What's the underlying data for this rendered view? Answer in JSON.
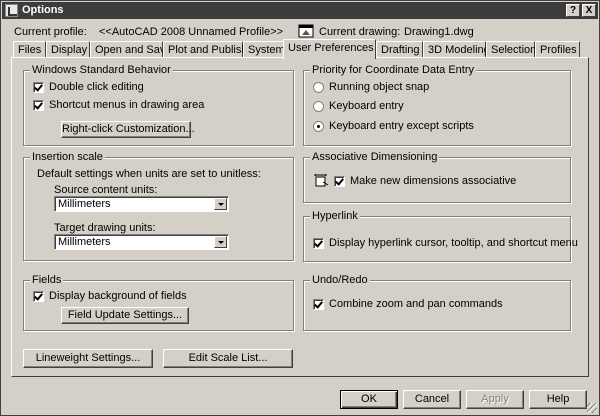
{
  "window": {
    "title": "Options",
    "help_glyph": "?",
    "close_glyph": "X"
  },
  "profile": {
    "label": "Current profile:",
    "value": "<<AutoCAD 2008 Unnamed Profile>>",
    "drawing_label": "Current drawing:",
    "drawing_value": "Drawing1.dwg"
  },
  "tabs": [
    {
      "label": "Files"
    },
    {
      "label": "Display"
    },
    {
      "label": "Open and Save"
    },
    {
      "label": "Plot and Publish"
    },
    {
      "label": "System"
    },
    {
      "label": "User Preferences"
    },
    {
      "label": "Drafting"
    },
    {
      "label": "3D Modeling"
    },
    {
      "label": "Selection"
    },
    {
      "label": "Profiles"
    }
  ],
  "windows_behavior": {
    "title": "Windows Standard Behavior",
    "double_click": {
      "label": "Double click editing",
      "checked": true
    },
    "shortcut_menus": {
      "label": "Shortcut menus in drawing area",
      "checked": true
    },
    "right_click_button": "Right-click Customization..."
  },
  "insertion_scale": {
    "title": "Insertion scale",
    "description": "Default settings when units are set to unitless:",
    "source_label": "Source content units:",
    "source_value": "Millimeters",
    "target_label": "Target drawing units:",
    "target_value": "Millimeters"
  },
  "fields": {
    "title": "Fields",
    "display_background": {
      "label": "Display background of fields",
      "checked": true
    },
    "update_button": "Field Update Settings..."
  },
  "bottom_buttons": {
    "lineweight": "Lineweight Settings...",
    "edit_scale": "Edit Scale List..."
  },
  "priority": {
    "title": "Priority for Coordinate Data Entry",
    "options": [
      {
        "label": "Running object snap",
        "selected": false
      },
      {
        "label": "Keyboard entry",
        "selected": false
      },
      {
        "label": "Keyboard entry except scripts",
        "selected": true
      }
    ]
  },
  "associative": {
    "title": "Associative Dimensioning",
    "make_associative": {
      "label": "Make new dimensions associative",
      "checked": true
    }
  },
  "hyperlink": {
    "title": "Hyperlink",
    "display_cursor": {
      "label": "Display hyperlink cursor, tooltip, and shortcut menu",
      "checked": true
    }
  },
  "undo_redo": {
    "title": "Undo/Redo",
    "combine_zoom": {
      "label": "Combine zoom and pan commands",
      "checked": true
    }
  },
  "dialog_buttons": {
    "ok": "OK",
    "cancel": "Cancel",
    "apply": "Apply",
    "help": "Help"
  }
}
